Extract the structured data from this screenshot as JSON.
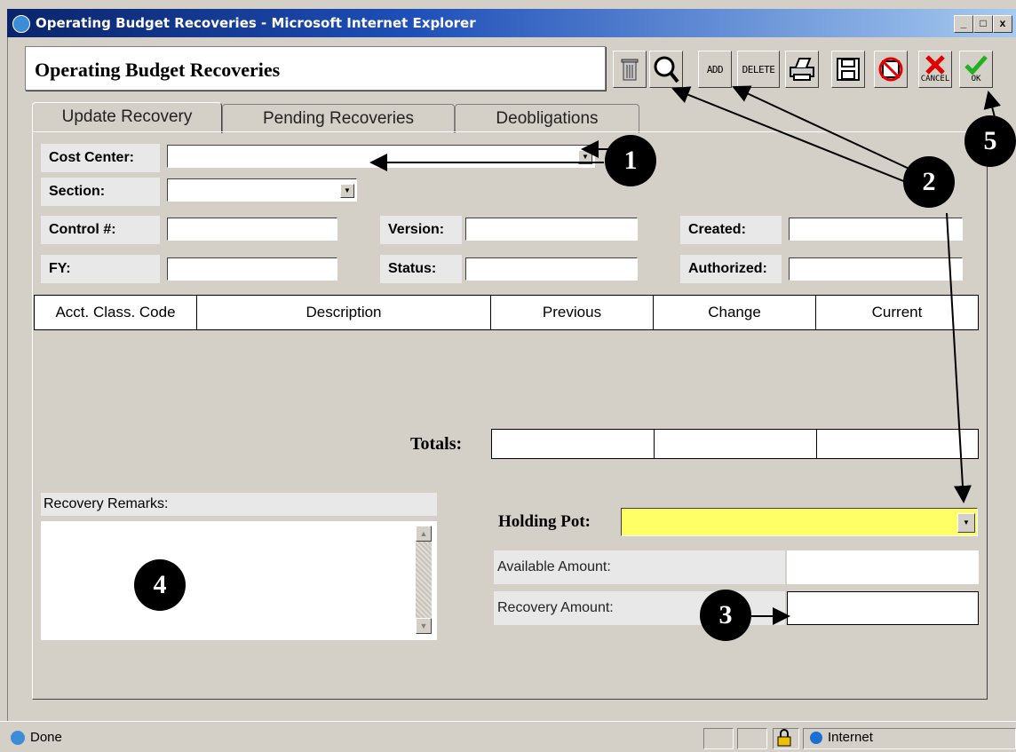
{
  "window": {
    "title": "Operating Budget Recoveries - Microsoft Internet Explorer",
    "controls": [
      "_",
      "□",
      "x"
    ]
  },
  "header": {
    "title": "Operating Budget Recoveries"
  },
  "toolbar": {
    "add_label": "ADD",
    "delete_label": "DELETE",
    "cancel_label": "CANCEL",
    "ok_label": "OK",
    "icons": [
      "trash-icon",
      "search-icon",
      "add-button",
      "delete-button",
      "print-icon",
      "save-icon",
      "no-save-icon",
      "cancel-icon",
      "ok-icon"
    ]
  },
  "tabs": [
    "Update Recovery",
    "Pending Recoveries",
    "Deobligations"
  ],
  "form": {
    "cost_center_label": "Cost Center:",
    "section_label": "Section:",
    "control_label": "Control #:",
    "fy_label": "FY:",
    "version_label": "Version:",
    "status_label": "Status:",
    "created_label": "Created:",
    "authorized_label": "Authorized:"
  },
  "grid": {
    "columns": [
      "Acct. Class. Code",
      "Description",
      "Previous",
      "Change",
      "Current"
    ]
  },
  "totals_label": "Totals:",
  "remarks_label": "Recovery Remarks:",
  "holding_pot_label": "Holding Pot:",
  "available_amount_label": "Available Amount:",
  "recovery_amount_label": "Recovery Amount:",
  "statusbar": {
    "done": "Done",
    "zone": "Internet"
  },
  "callouts": [
    "1",
    "2",
    "3",
    "4",
    "5"
  ],
  "colors": {
    "holding_pot_bg": "#ffff66",
    "titlebar": "#0a246a"
  }
}
